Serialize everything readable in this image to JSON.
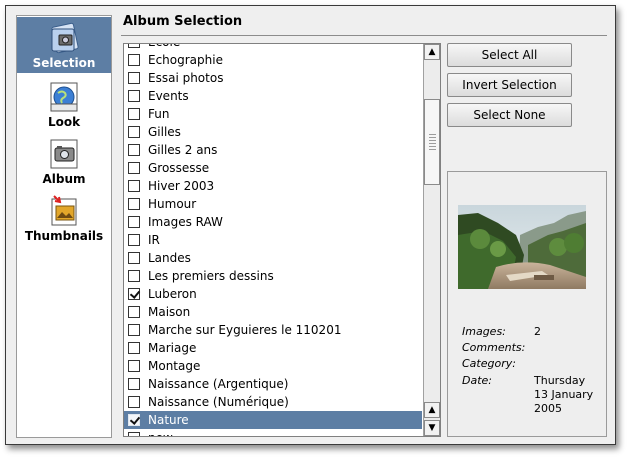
{
  "sidebar": {
    "items": [
      {
        "label": "Selection",
        "icon": "selection-icon",
        "active": true
      },
      {
        "label": "Look",
        "icon": "look-icon"
      },
      {
        "label": "Album",
        "icon": "album-icon"
      },
      {
        "label": "Thumbnails",
        "icon": "thumbnails-icon"
      }
    ]
  },
  "header": {
    "title": "Album Selection"
  },
  "albums": [
    {
      "label": "Ecole",
      "checked": false
    },
    {
      "label": "Echographie",
      "checked": false
    },
    {
      "label": "Essai photos",
      "checked": false
    },
    {
      "label": "Events",
      "checked": false
    },
    {
      "label": "Fun",
      "checked": false
    },
    {
      "label": "Gilles",
      "checked": false
    },
    {
      "label": "Gilles 2 ans",
      "checked": false
    },
    {
      "label": "Grossesse",
      "checked": false
    },
    {
      "label": "Hiver 2003",
      "checked": false
    },
    {
      "label": "Humour",
      "checked": false
    },
    {
      "label": "Images RAW",
      "checked": false
    },
    {
      "label": "IR",
      "checked": false
    },
    {
      "label": "Landes",
      "checked": false
    },
    {
      "label": "Les premiers dessins",
      "checked": false
    },
    {
      "label": "Luberon",
      "checked": true
    },
    {
      "label": "Maison",
      "checked": false
    },
    {
      "label": "Marche sur Eyguieres le 110201",
      "checked": false
    },
    {
      "label": "Mariage",
      "checked": false
    },
    {
      "label": "Montage",
      "checked": false
    },
    {
      "label": "Naissance (Argentique)",
      "checked": false
    },
    {
      "label": "Naissance (Numérique)",
      "checked": false
    },
    {
      "label": "Nature",
      "checked": true,
      "selected": true
    },
    {
      "label": "new",
      "checked": false
    }
  ],
  "buttons": {
    "select_all": "Select All",
    "invert": "Invert Selection",
    "select_none": "Select None"
  },
  "info": {
    "images_label": "Images:",
    "images_value": "2",
    "comments_label": "Comments:",
    "comments_value": "",
    "category_label": "Category:",
    "category_value": "",
    "date_label": "Date:",
    "date_value_line1": "Thursday",
    "date_value_line2": "13 January",
    "date_value_line3": "2005"
  },
  "colors": {
    "selection": "#5d7ea4"
  }
}
